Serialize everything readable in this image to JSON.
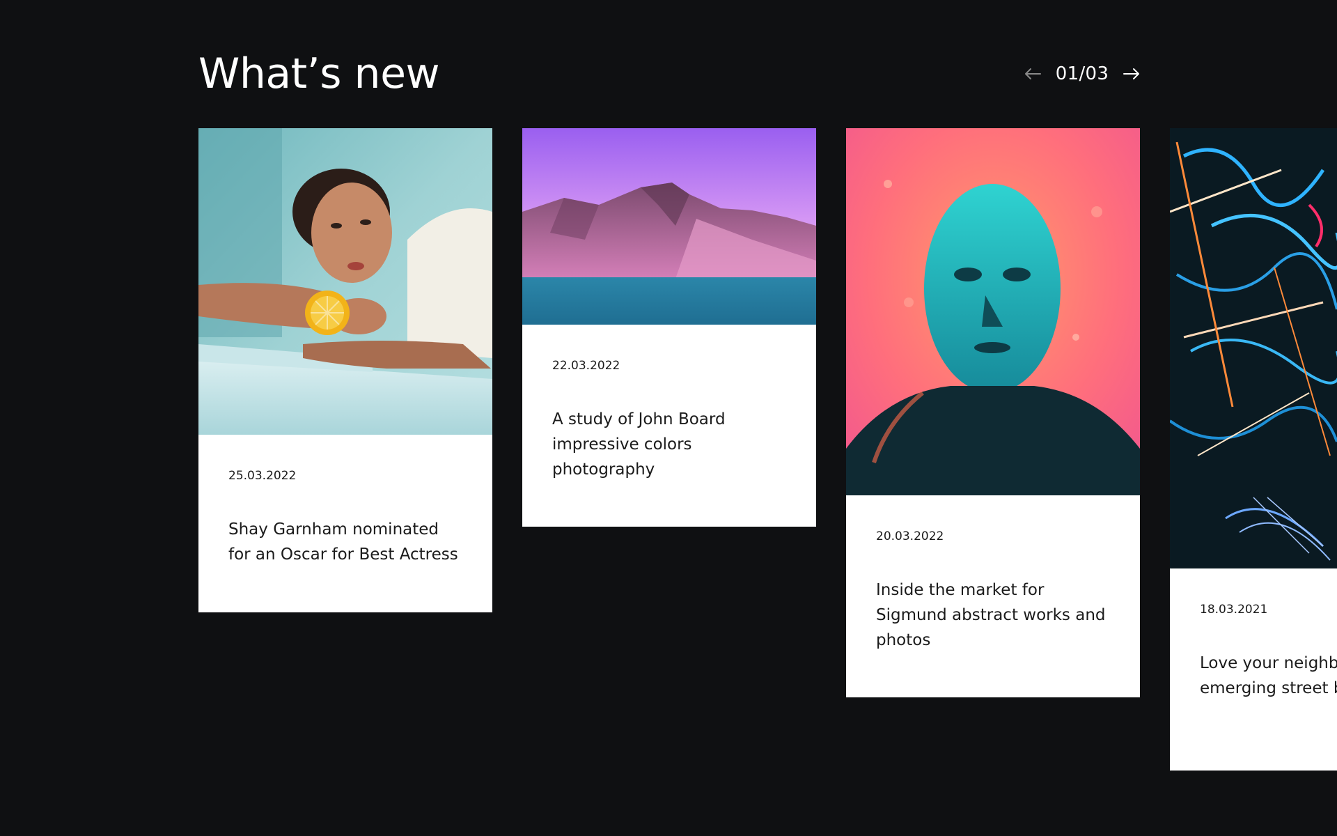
{
  "section": {
    "title": "What’s new"
  },
  "pager": {
    "current": "01/03",
    "prev_icon": "arrow-left-icon",
    "next_icon": "arrow-right-icon"
  },
  "cards": [
    {
      "date": "25.03.2022",
      "headline": "Shay Garnham nominated for an Oscar for Best Actress",
      "image": "portrait-woman-lemon-image"
    },
    {
      "date": "22.03.2022",
      "headline": "A study of John Board impressive colors photography",
      "image": "pink-mountain-lake-image"
    },
    {
      "date": "20.03.2022",
      "headline": "Inside the market for Sigmund abstract works and photos",
      "image": "face-behind-wet-glass-image"
    },
    {
      "date": "18.03.2021",
      "headline": "Love your neighbour new emerging street brand",
      "image": "neon-lights-abstract-image"
    }
  ],
  "colors": {
    "background": "#0f1012",
    "card": "#ffffff",
    "text_dark": "#1b1b1b",
    "text_light": "#ffffff"
  }
}
